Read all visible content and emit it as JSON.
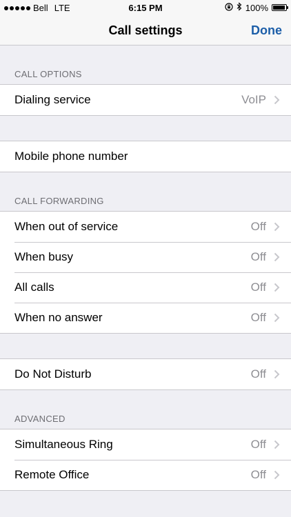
{
  "status_bar": {
    "carrier": "Bell",
    "network": "LTE",
    "time": "6:15 PM",
    "battery": "100%"
  },
  "nav": {
    "title": "Call settings",
    "done_label": "Done"
  },
  "sections": {
    "call_options": {
      "header": "CALL OPTIONS",
      "dialing_service": {
        "label": "Dialing service",
        "value": "VoIP"
      }
    },
    "mobile": {
      "mobile_phone_number": {
        "label": "Mobile phone number"
      }
    },
    "call_forwarding": {
      "header": "CALL FORWARDING",
      "out_of_service": {
        "label": "When out of service",
        "value": "Off"
      },
      "busy": {
        "label": "When busy",
        "value": "Off"
      },
      "all_calls": {
        "label": "All calls",
        "value": "Off"
      },
      "no_answer": {
        "label": "When no answer",
        "value": "Off"
      }
    },
    "dnd": {
      "do_not_disturb": {
        "label": "Do Not Disturb",
        "value": "Off"
      }
    },
    "advanced": {
      "header": "ADVANCED",
      "simultaneous_ring": {
        "label": "Simultaneous Ring",
        "value": "Off"
      },
      "remote_office": {
        "label": "Remote Office",
        "value": "Off"
      }
    }
  },
  "colors": {
    "background": "#efeff4",
    "accent": "#1c5ea8",
    "secondary_text": "#8e8e93",
    "separator": "#c8c7cc"
  },
  "icons": [
    "signal-dots-icon",
    "orientation-lock-icon",
    "bluetooth-icon",
    "battery-icon",
    "chevron-right-icon"
  ]
}
